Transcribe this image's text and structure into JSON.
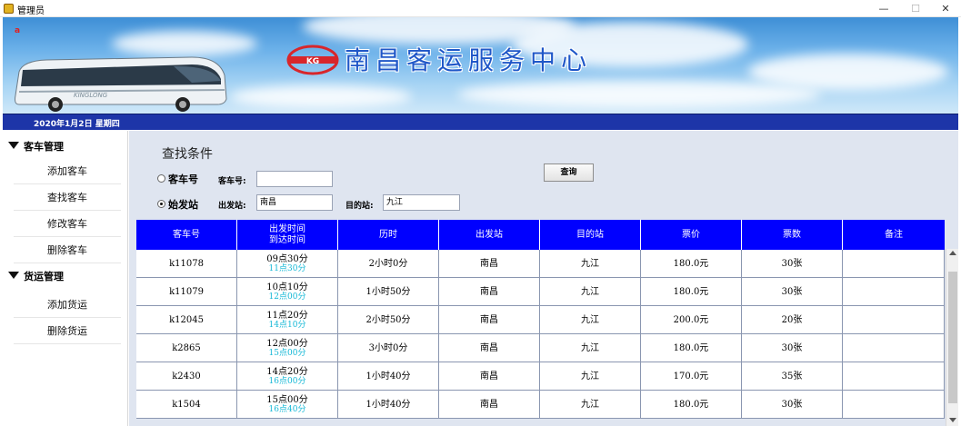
{
  "window": {
    "title": "管理员",
    "minimize": "—",
    "maximize": "☐",
    "close": "✕"
  },
  "banner": {
    "corner_mark": "a",
    "title": "南昌客运服务中心",
    "logo_text": "KG"
  },
  "datebar": {
    "text": "2020年1月2日  星期四"
  },
  "sidebar": {
    "groups": [
      {
        "label": "客车管理",
        "items": [
          {
            "label": "添加客车"
          },
          {
            "label": "查找客车"
          },
          {
            "label": "修改客车"
          },
          {
            "label": "删除客车"
          }
        ]
      },
      {
        "label": "货运管理",
        "items": [
          {
            "label": "添加货运"
          },
          {
            "label": "删除货运"
          }
        ]
      }
    ]
  },
  "search": {
    "section_title": "查找条件",
    "radio_bus_label": "客车号",
    "radio_station_label": "始发站",
    "bus_no_label": "客车号:",
    "bus_no_value": "",
    "from_label": "出发站:",
    "from_value": "南昌",
    "to_label": "目的站:",
    "to_value": "九江",
    "button_label": "查询",
    "selected": "始发站"
  },
  "table": {
    "headers": [
      "客车号",
      "出发时间",
      "到达时间",
      "历时",
      "出发站",
      "目的站",
      "票价",
      "票数",
      "备注"
    ],
    "rows": [
      {
        "bus": "k11078",
        "depart": "09点30分",
        "arrive": "11点30分",
        "duration": "2小时0分",
        "from": "南昌",
        "to": "九江",
        "price": "180.0元",
        "tickets": "30张",
        "note": ""
      },
      {
        "bus": "k11079",
        "depart": "10点10分",
        "arrive": "12点00分",
        "duration": "1小时50分",
        "from": "南昌",
        "to": "九江",
        "price": "180.0元",
        "tickets": "30张",
        "note": ""
      },
      {
        "bus": "k12045",
        "depart": "11点20分",
        "arrive": "14点10分",
        "duration": "2小时50分",
        "from": "南昌",
        "to": "九江",
        "price": "200.0元",
        "tickets": "20张",
        "note": ""
      },
      {
        "bus": "k2865",
        "depart": "12点00分",
        "arrive": "15点00分",
        "duration": "3小时0分",
        "from": "南昌",
        "to": "九江",
        "price": "180.0元",
        "tickets": "30张",
        "note": ""
      },
      {
        "bus": "k2430",
        "depart": "14点20分",
        "arrive": "16点00分",
        "duration": "1小时40分",
        "from": "南昌",
        "to": "九江",
        "price": "170.0元",
        "tickets": "35张",
        "note": ""
      },
      {
        "bus": "k1504",
        "depart": "15点00分",
        "arrive": "16点40分",
        "duration": "1小时40分",
        "from": "南昌",
        "to": "九江",
        "price": "180.0元",
        "tickets": "30张",
        "note": ""
      }
    ]
  },
  "colors": {
    "table_header": "#0000ff",
    "datebar": "#1d35a8",
    "arrive_time": "#15b8d6",
    "banner_title": "#1f57c8",
    "logo_red": "#d8262b"
  }
}
